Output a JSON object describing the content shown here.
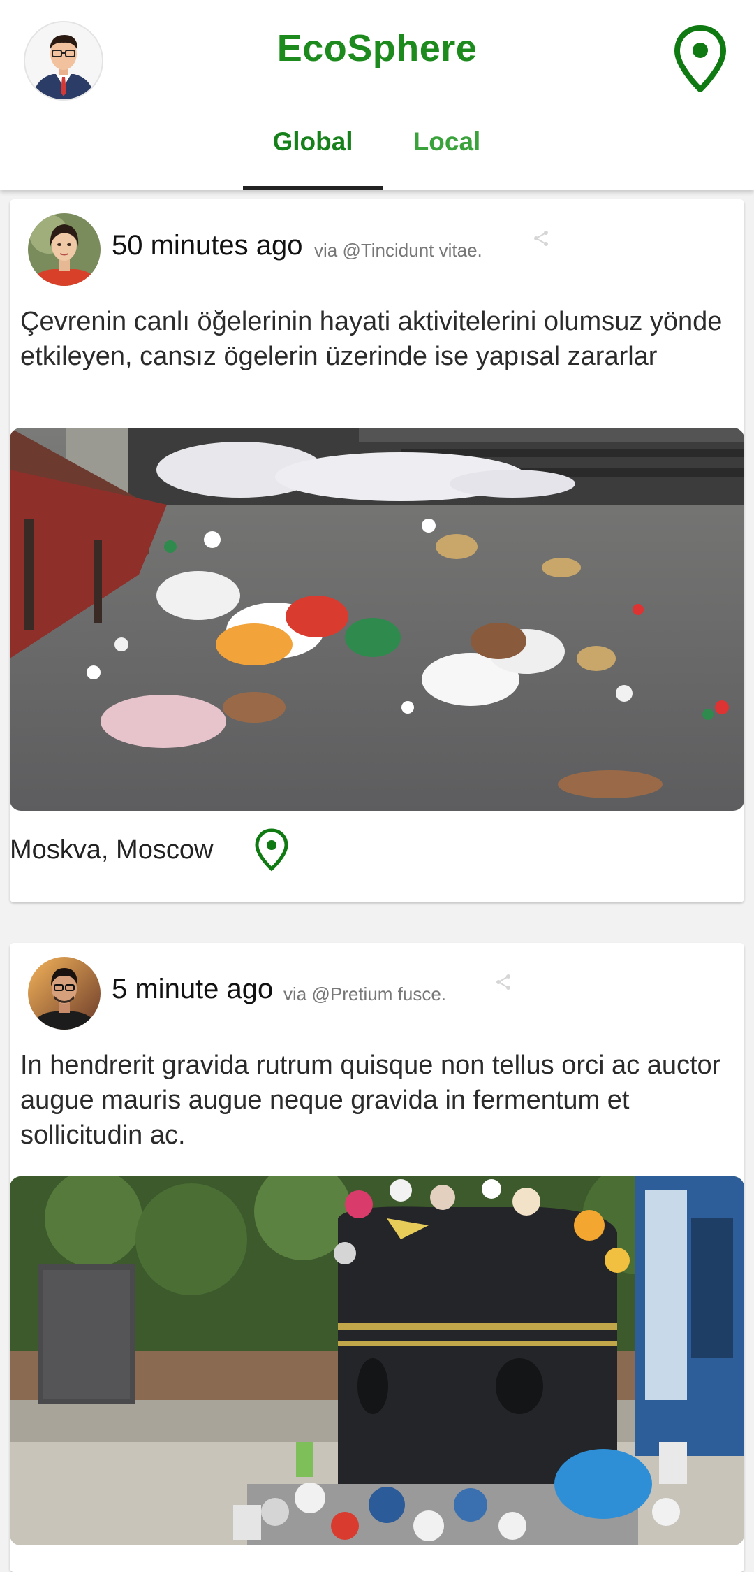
{
  "app": {
    "title": "EcoSphere"
  },
  "header": {
    "profile_avatar": "profile-avatar",
    "location_icon": "location-pin-icon",
    "accent_color": "#1d8a1d"
  },
  "tabs": [
    {
      "label": "Global",
      "active": true
    },
    {
      "label": "Local",
      "active": false
    }
  ],
  "posts": [
    {
      "time": "50 minutes ago",
      "via": "via @Tincidunt vitae.",
      "text": "Çevrenin canlı öğelerinin hayati aktivitelerini olumsuz yönde etkileyen, cansız ögelerin üzerinde ise yapısal zararlar",
      "image": "street-litter-photo",
      "location": "Moskva, Moscow"
    },
    {
      "time": "5 minute ago",
      "via": "via @Pretium fusce.",
      "text": "In hendrerit gravida rutrum quisque non tellus orci ac auctor augue mauris augue neque gravida in fermentum et sollicitudin ac.",
      "image": "overflowing-bin-photo"
    }
  ]
}
